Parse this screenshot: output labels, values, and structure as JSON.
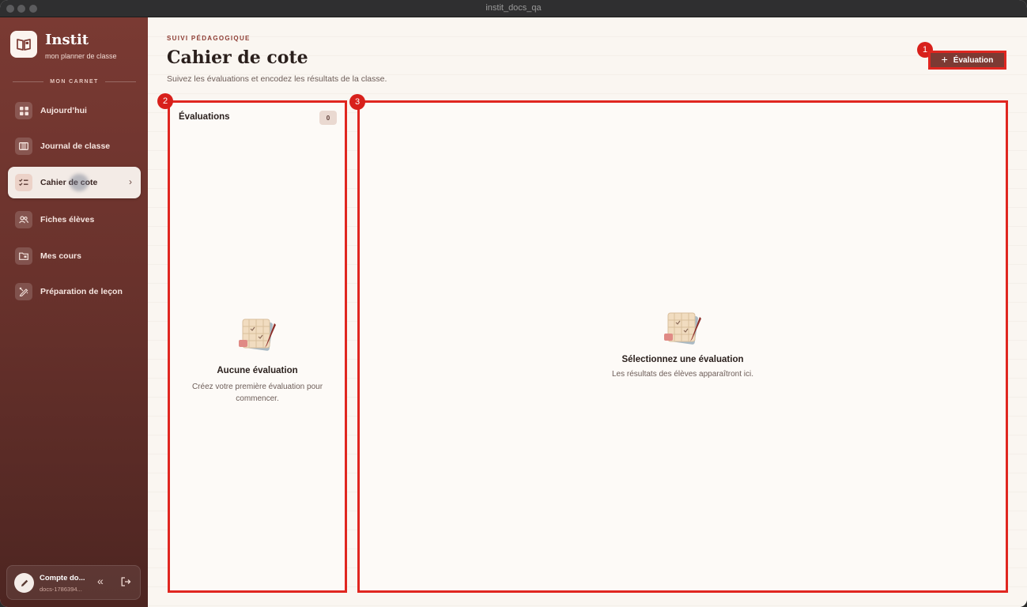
{
  "window": {
    "title": "instit_docs_qa"
  },
  "sidebar": {
    "app_name": "Instit",
    "app_subtitle": "mon planner de classe",
    "section_label": "MON CARNET",
    "items": [
      {
        "label": "Aujourd’hui",
        "icon": "grid-icon"
      },
      {
        "label": "Journal de classe",
        "icon": "calendar-icon"
      },
      {
        "label": "Cahier de cote",
        "icon": "checklist-icon",
        "active": true
      },
      {
        "label": "Fiches élèves",
        "icon": "users-icon"
      },
      {
        "label": "Mes cours",
        "icon": "folder-icon"
      },
      {
        "label": "Préparation de leçon",
        "icon": "pencil-ruler-icon"
      }
    ],
    "account": {
      "name": "Compte do...",
      "id": "docs-1786394..."
    }
  },
  "header": {
    "eyebrow": "SUIVI PÉDAGOGIQUE",
    "title": "Cahier de cote",
    "subtitle": "Suivez les évaluations et encodez les résultats de la classe.",
    "add_button": "Évaluation"
  },
  "annotations": [
    "1",
    "2",
    "3"
  ],
  "evaluations_panel": {
    "title": "Évaluations",
    "count": "0",
    "empty_title": "Aucune évaluation",
    "empty_text": "Créez votre première évaluation pour commencer."
  },
  "results_panel": {
    "empty_title": "Sélectionnez une évaluation",
    "empty_text": "Les résultats des élèves apparaîtront ici."
  },
  "colors": {
    "accent": "#7c3a33",
    "annotation": "#e02620",
    "sidebar_top": "#7a3a33",
    "sidebar_bottom": "#4d2521"
  }
}
